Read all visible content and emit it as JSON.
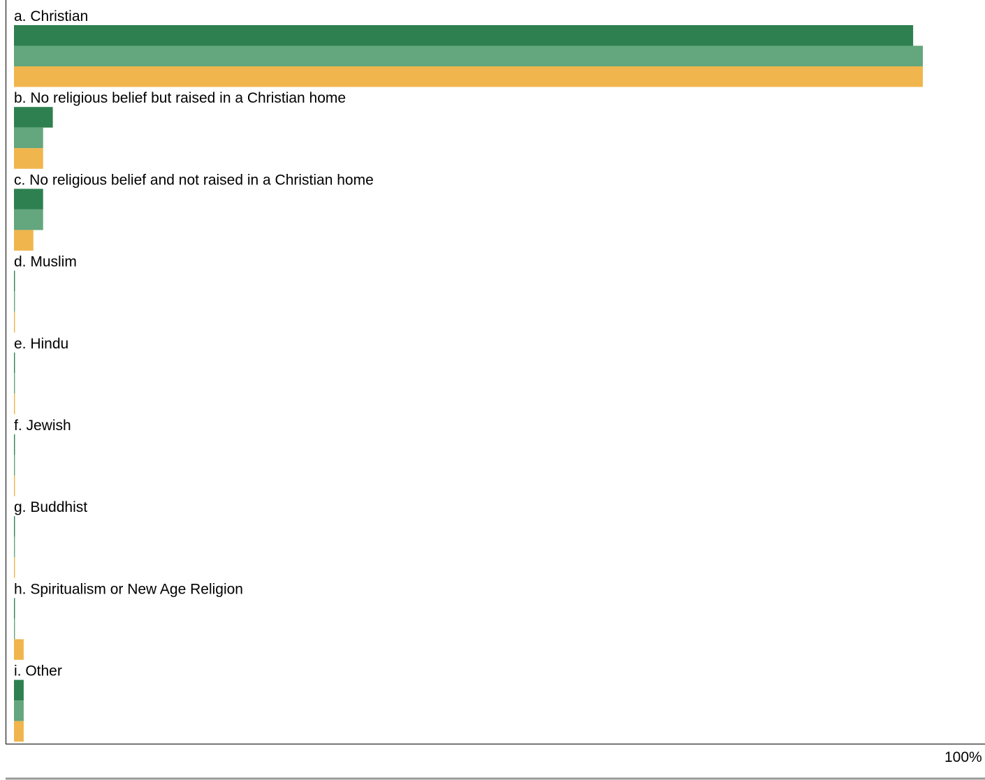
{
  "chart_data": {
    "type": "bar",
    "orientation": "horizontal",
    "categories": [
      "a. Christian",
      "b. No religious belief but raised in a Christian home",
      "c. No religious belief and not raised in a Christian home",
      "d. Muslim",
      "e. Hindu",
      "f. Jewish",
      "g. Buddhist",
      "h. Spiritualism or New Age Religion",
      "i. Other"
    ],
    "series": [
      {
        "color": "#2e8050",
        "values": [
          92.6,
          4.0,
          3.0,
          0.1,
          0.1,
          0.1,
          0.1,
          0.1,
          1.0
        ]
      },
      {
        "color": "#64a67e",
        "values": [
          93.6,
          3.0,
          3.0,
          0.1,
          0.1,
          0.1,
          0.1,
          0.1,
          1.0
        ]
      },
      {
        "color": "#f0b54c",
        "values": [
          93.6,
          3.0,
          2.0,
          0.1,
          0.1,
          0.1,
          0.1,
          1.0,
          1.0
        ]
      }
    ],
    "xlim": [
      0,
      100
    ],
    "x_tick_labels": [
      "100%"
    ],
    "grid": false,
    "legend": "none",
    "title": "",
    "xlabel": "",
    "ylabel": ""
  },
  "colors": {
    "axis": "#000000",
    "bottom_rule": "#999999"
  }
}
